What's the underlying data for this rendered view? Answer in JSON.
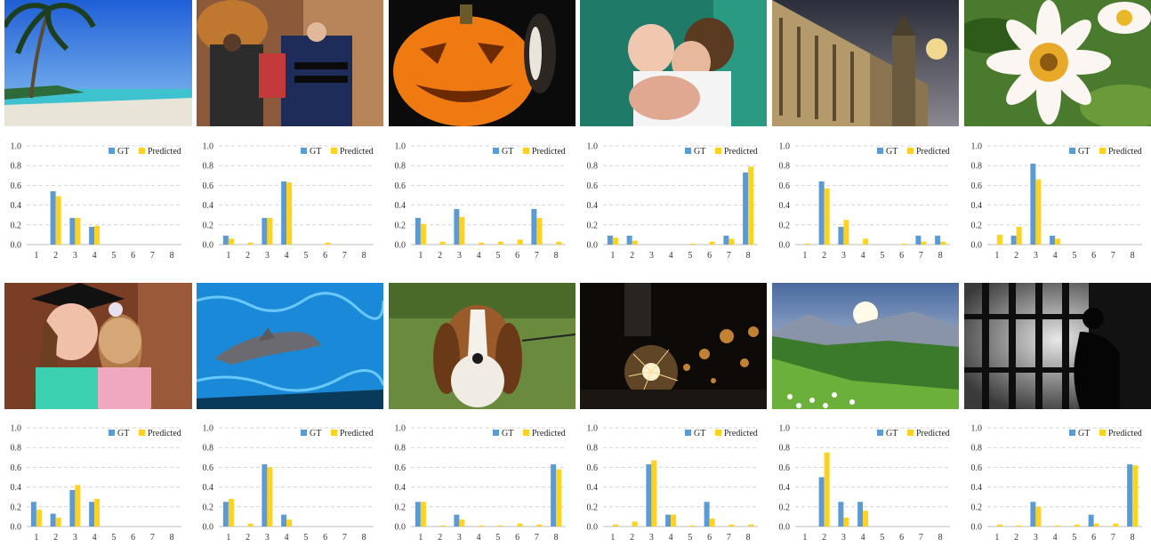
{
  "colors": {
    "gt": "#5B9BD5",
    "predicted": "#FFD21F",
    "grid": "#d4d4d4"
  },
  "legend": {
    "gt": "GT",
    "predicted": "Predicted"
  },
  "chart_data": [
    {
      "type": "bar",
      "categories": [
        "1",
        "2",
        "3",
        "4",
        "5",
        "6",
        "7",
        "8"
      ],
      "yticks": [
        "0.0",
        "0.2",
        "0.4",
        "0.6",
        "0.8",
        "1.0"
      ],
      "ylim": [
        0,
        1
      ],
      "series": [
        {
          "name": "GT",
          "values": [
            0,
            0.54,
            0.27,
            0.18,
            0,
            0,
            0,
            0
          ]
        },
        {
          "name": "Predicted",
          "values": [
            0,
            0.49,
            0.27,
            0.19,
            0,
            0,
            0,
            0
          ]
        }
      ]
    },
    {
      "type": "bar",
      "categories": [
        "1",
        "2",
        "3",
        "4",
        "5",
        "6",
        "7",
        "8"
      ],
      "yticks": [
        "0.0",
        "0.2",
        "0.4",
        "0.6",
        "0.8",
        "1.0"
      ],
      "ylim": [
        0,
        1
      ],
      "series": [
        {
          "name": "GT",
          "values": [
            0.09,
            0,
            0.27,
            0.64,
            0,
            0,
            0,
            0
          ]
        },
        {
          "name": "Predicted",
          "values": [
            0.06,
            0.02,
            0.27,
            0.63,
            0,
            0.02,
            0,
            0
          ]
        }
      ]
    },
    {
      "type": "bar",
      "categories": [
        "1",
        "2",
        "3",
        "4",
        "5",
        "6",
        "7",
        "8"
      ],
      "yticks": [
        "0.0",
        "0.2",
        "0.4",
        "0.6",
        "0.8",
        "1.0"
      ],
      "ylim": [
        0,
        1
      ],
      "series": [
        {
          "name": "GT",
          "values": [
            0.27,
            0,
            0.36,
            0,
            0,
            0,
            0.36,
            0
          ]
        },
        {
          "name": "Predicted",
          "values": [
            0.21,
            0.03,
            0.28,
            0.02,
            0.03,
            0.05,
            0.27,
            0.03
          ]
        }
      ]
    },
    {
      "type": "bar",
      "categories": [
        "1",
        "2",
        "3",
        "4",
        "5",
        "6",
        "7",
        "8"
      ],
      "yticks": [
        "0.0",
        "0.2",
        "0.4",
        "0.6",
        "0.8",
        "1.0"
      ],
      "ylim": [
        0,
        1
      ],
      "series": [
        {
          "name": "GT",
          "values": [
            0.09,
            0.09,
            0,
            0,
            0,
            0,
            0.09,
            0.73
          ]
        },
        {
          "name": "Predicted",
          "values": [
            0.07,
            0.04,
            0,
            0,
            0.01,
            0.03,
            0.06,
            0.79
          ]
        }
      ]
    },
    {
      "type": "bar",
      "categories": [
        "1",
        "2",
        "3",
        "4",
        "5",
        "6",
        "7",
        "8"
      ],
      "yticks": [
        "0.0",
        "0.2",
        "0.4",
        "0.6",
        "0.8",
        "1.0"
      ],
      "ylim": [
        0,
        1
      ],
      "series": [
        {
          "name": "GT",
          "values": [
            0,
            0.64,
            0.18,
            0,
            0,
            0,
            0.09,
            0.09
          ]
        },
        {
          "name": "Predicted",
          "values": [
            0.01,
            0.57,
            0.25,
            0.06,
            0,
            0.01,
            0.03,
            0.03
          ]
        }
      ]
    },
    {
      "type": "bar",
      "categories": [
        "1",
        "2",
        "3",
        "4",
        "5",
        "6",
        "7",
        "8"
      ],
      "yticks": [
        "0.0",
        "0.2",
        "0.4",
        "0.6",
        "0.8",
        "1.0"
      ],
      "ylim": [
        0,
        1
      ],
      "series": [
        {
          "name": "GT",
          "values": [
            0,
            0.09,
            0.82,
            0.09,
            0,
            0,
            0,
            0
          ]
        },
        {
          "name": "Predicted",
          "values": [
            0.1,
            0.18,
            0.66,
            0.06,
            0,
            0,
            0,
            0
          ]
        }
      ]
    },
    {
      "type": "bar",
      "categories": [
        "1",
        "2",
        "3",
        "4",
        "5",
        "6",
        "7",
        "8"
      ],
      "yticks": [
        "0.0",
        "0.2",
        "0.4",
        "0.6",
        "0.8",
        "1.0"
      ],
      "ylim": [
        0,
        1
      ],
      "series": [
        {
          "name": "GT",
          "values": [
            0.25,
            0.13,
            0.37,
            0.25,
            0,
            0,
            0,
            0
          ]
        },
        {
          "name": "Predicted",
          "values": [
            0.17,
            0.09,
            0.42,
            0.28,
            0,
            0,
            0,
            0
          ]
        }
      ]
    },
    {
      "type": "bar",
      "categories": [
        "1",
        "2",
        "3",
        "4",
        "5",
        "6",
        "7",
        "8"
      ],
      "yticks": [
        "0.0",
        "0.2",
        "0.4",
        "0.6",
        "0.8",
        "1.0"
      ],
      "ylim": [
        0,
        1
      ],
      "series": [
        {
          "name": "GT",
          "values": [
            0.25,
            0,
            0.63,
            0.12,
            0,
            0,
            0,
            0
          ]
        },
        {
          "name": "Predicted",
          "values": [
            0.28,
            0.03,
            0.6,
            0.07,
            0,
            0,
            0,
            0
          ]
        }
      ]
    },
    {
      "type": "bar",
      "categories": [
        "1",
        "2",
        "3",
        "4",
        "5",
        "6",
        "7",
        "8"
      ],
      "yticks": [
        "0.0",
        "0.2",
        "0.4",
        "0.6",
        "0.8",
        "1.0"
      ],
      "ylim": [
        0,
        1
      ],
      "series": [
        {
          "name": "GT",
          "values": [
            0.25,
            0,
            0.12,
            0,
            0,
            0,
            0,
            0.63
          ]
        },
        {
          "name": "Predicted",
          "values": [
            0.25,
            0.01,
            0.07,
            0.01,
            0.01,
            0.03,
            0.02,
            0.58
          ]
        }
      ]
    },
    {
      "type": "bar",
      "categories": [
        "1",
        "2",
        "3",
        "4",
        "5",
        "6",
        "7",
        "8"
      ],
      "yticks": [
        "0.0",
        "0.2",
        "0.4",
        "0.6",
        "0.8",
        "1.0"
      ],
      "ylim": [
        0,
        1
      ],
      "series": [
        {
          "name": "GT",
          "values": [
            0,
            0,
            0.63,
            0.12,
            0,
            0.25,
            0,
            0
          ]
        },
        {
          "name": "Predicted",
          "values": [
            0.02,
            0.05,
            0.67,
            0.12,
            0.01,
            0.08,
            0.02,
            0.02
          ]
        }
      ]
    },
    {
      "type": "bar",
      "categories": [
        "1",
        "2",
        "3",
        "4",
        "5",
        "6",
        "7",
        "8"
      ],
      "yticks": [
        "0.0",
        "0.2",
        "0.4",
        "0.6",
        "0.8",
        "1.0"
      ],
      "ylim": [
        0,
        1
      ],
      "series": [
        {
          "name": "GT",
          "values": [
            0,
            0.5,
            0.25,
            0.25,
            0,
            0,
            0,
            0
          ]
        },
        {
          "name": "Predicted",
          "values": [
            0,
            0.75,
            0.09,
            0.16,
            0,
            0,
            0,
            0
          ]
        }
      ]
    },
    {
      "type": "bar",
      "categories": [
        "1",
        "2",
        "3",
        "4",
        "5",
        "6",
        "7",
        "8"
      ],
      "yticks": [
        "0.0",
        "0.2",
        "0.4",
        "0.6",
        "0.8",
        "1.0"
      ],
      "ylim": [
        0,
        1
      ],
      "series": [
        {
          "name": "GT",
          "values": [
            0,
            0,
            0.25,
            0,
            0,
            0.12,
            0,
            0.63
          ]
        },
        {
          "name": "Predicted",
          "values": [
            0.02,
            0.01,
            0.2,
            0.01,
            0.02,
            0.03,
            0.03,
            0.62
          ]
        }
      ]
    }
  ]
}
